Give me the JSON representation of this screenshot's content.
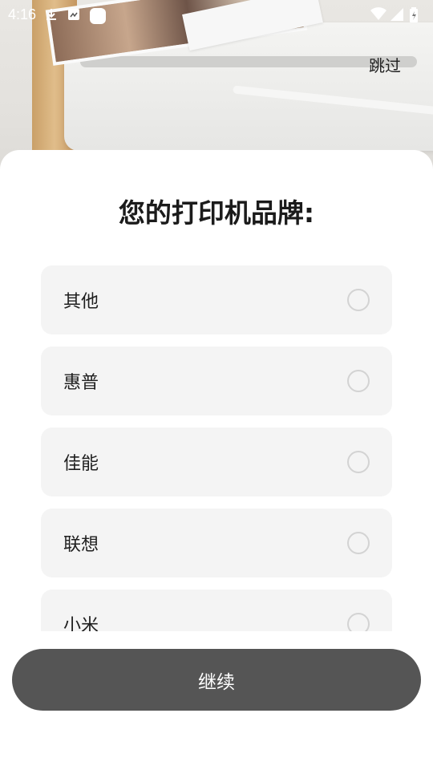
{
  "status_bar": {
    "time": "4:16",
    "left_icons": [
      "download-icon",
      "notification-icon",
      "app-icon"
    ],
    "right_icons": [
      "wifi-icon",
      "signal-icon",
      "battery-icon"
    ]
  },
  "header": {
    "skip_label": "跳过"
  },
  "main": {
    "title": "您的打印机品牌:",
    "options": [
      {
        "label": "其他"
      },
      {
        "label": "惠普"
      },
      {
        "label": "佳能"
      },
      {
        "label": "联想"
      },
      {
        "label": "小米"
      }
    ],
    "continue_label": "继续"
  },
  "colors": {
    "button_bg": "#555555",
    "option_bg": "#f4f4f4",
    "radio_border": "#d3d3d3"
  }
}
